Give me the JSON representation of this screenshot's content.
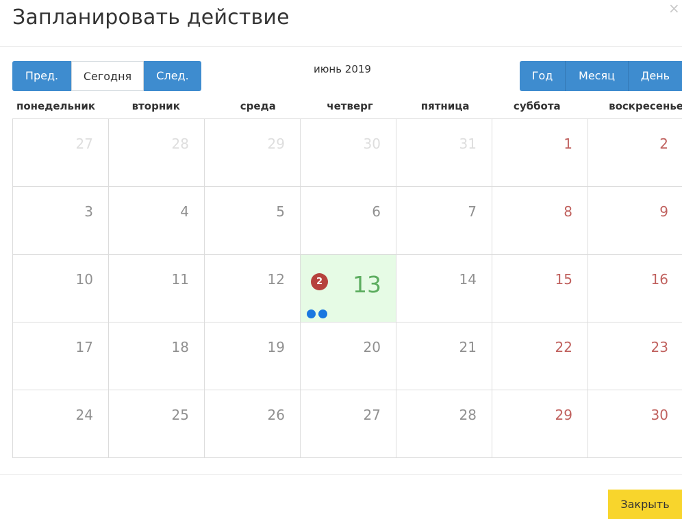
{
  "dialog": {
    "title": "Запланировать действие",
    "close_icon": "×",
    "close_button_label": "Закрыть"
  },
  "toolbar": {
    "prev_label": "Пред.",
    "today_label": "Сегодня",
    "next_label": "След.",
    "month_label": "июнь 2019",
    "year_label": "Год",
    "month_view_label": "Месяц",
    "day_view_label": "День"
  },
  "weekdays": [
    "понедельник",
    "вторник",
    "среда",
    "четверг",
    "пятница",
    "суббота",
    "воскресенье"
  ],
  "weeks": [
    [
      "27",
      "28",
      "29",
      "30",
      "31",
      "1",
      "2"
    ],
    [
      "3",
      "4",
      "5",
      "6",
      "7",
      "8",
      "9"
    ],
    [
      "10",
      "11",
      "12",
      "13",
      "14",
      "15",
      "16"
    ],
    [
      "17",
      "18",
      "19",
      "20",
      "21",
      "22",
      "23"
    ],
    [
      "24",
      "25",
      "26",
      "27",
      "28",
      "29",
      "30"
    ]
  ],
  "today_event": {
    "count": "2"
  },
  "colors": {
    "primary": "#3e8ccf",
    "today_bg": "#e6fbe5",
    "weekend": "#c0615e",
    "badge": "#b6423d",
    "dot": "#1a77e0",
    "close_button": "#f8d52c"
  }
}
